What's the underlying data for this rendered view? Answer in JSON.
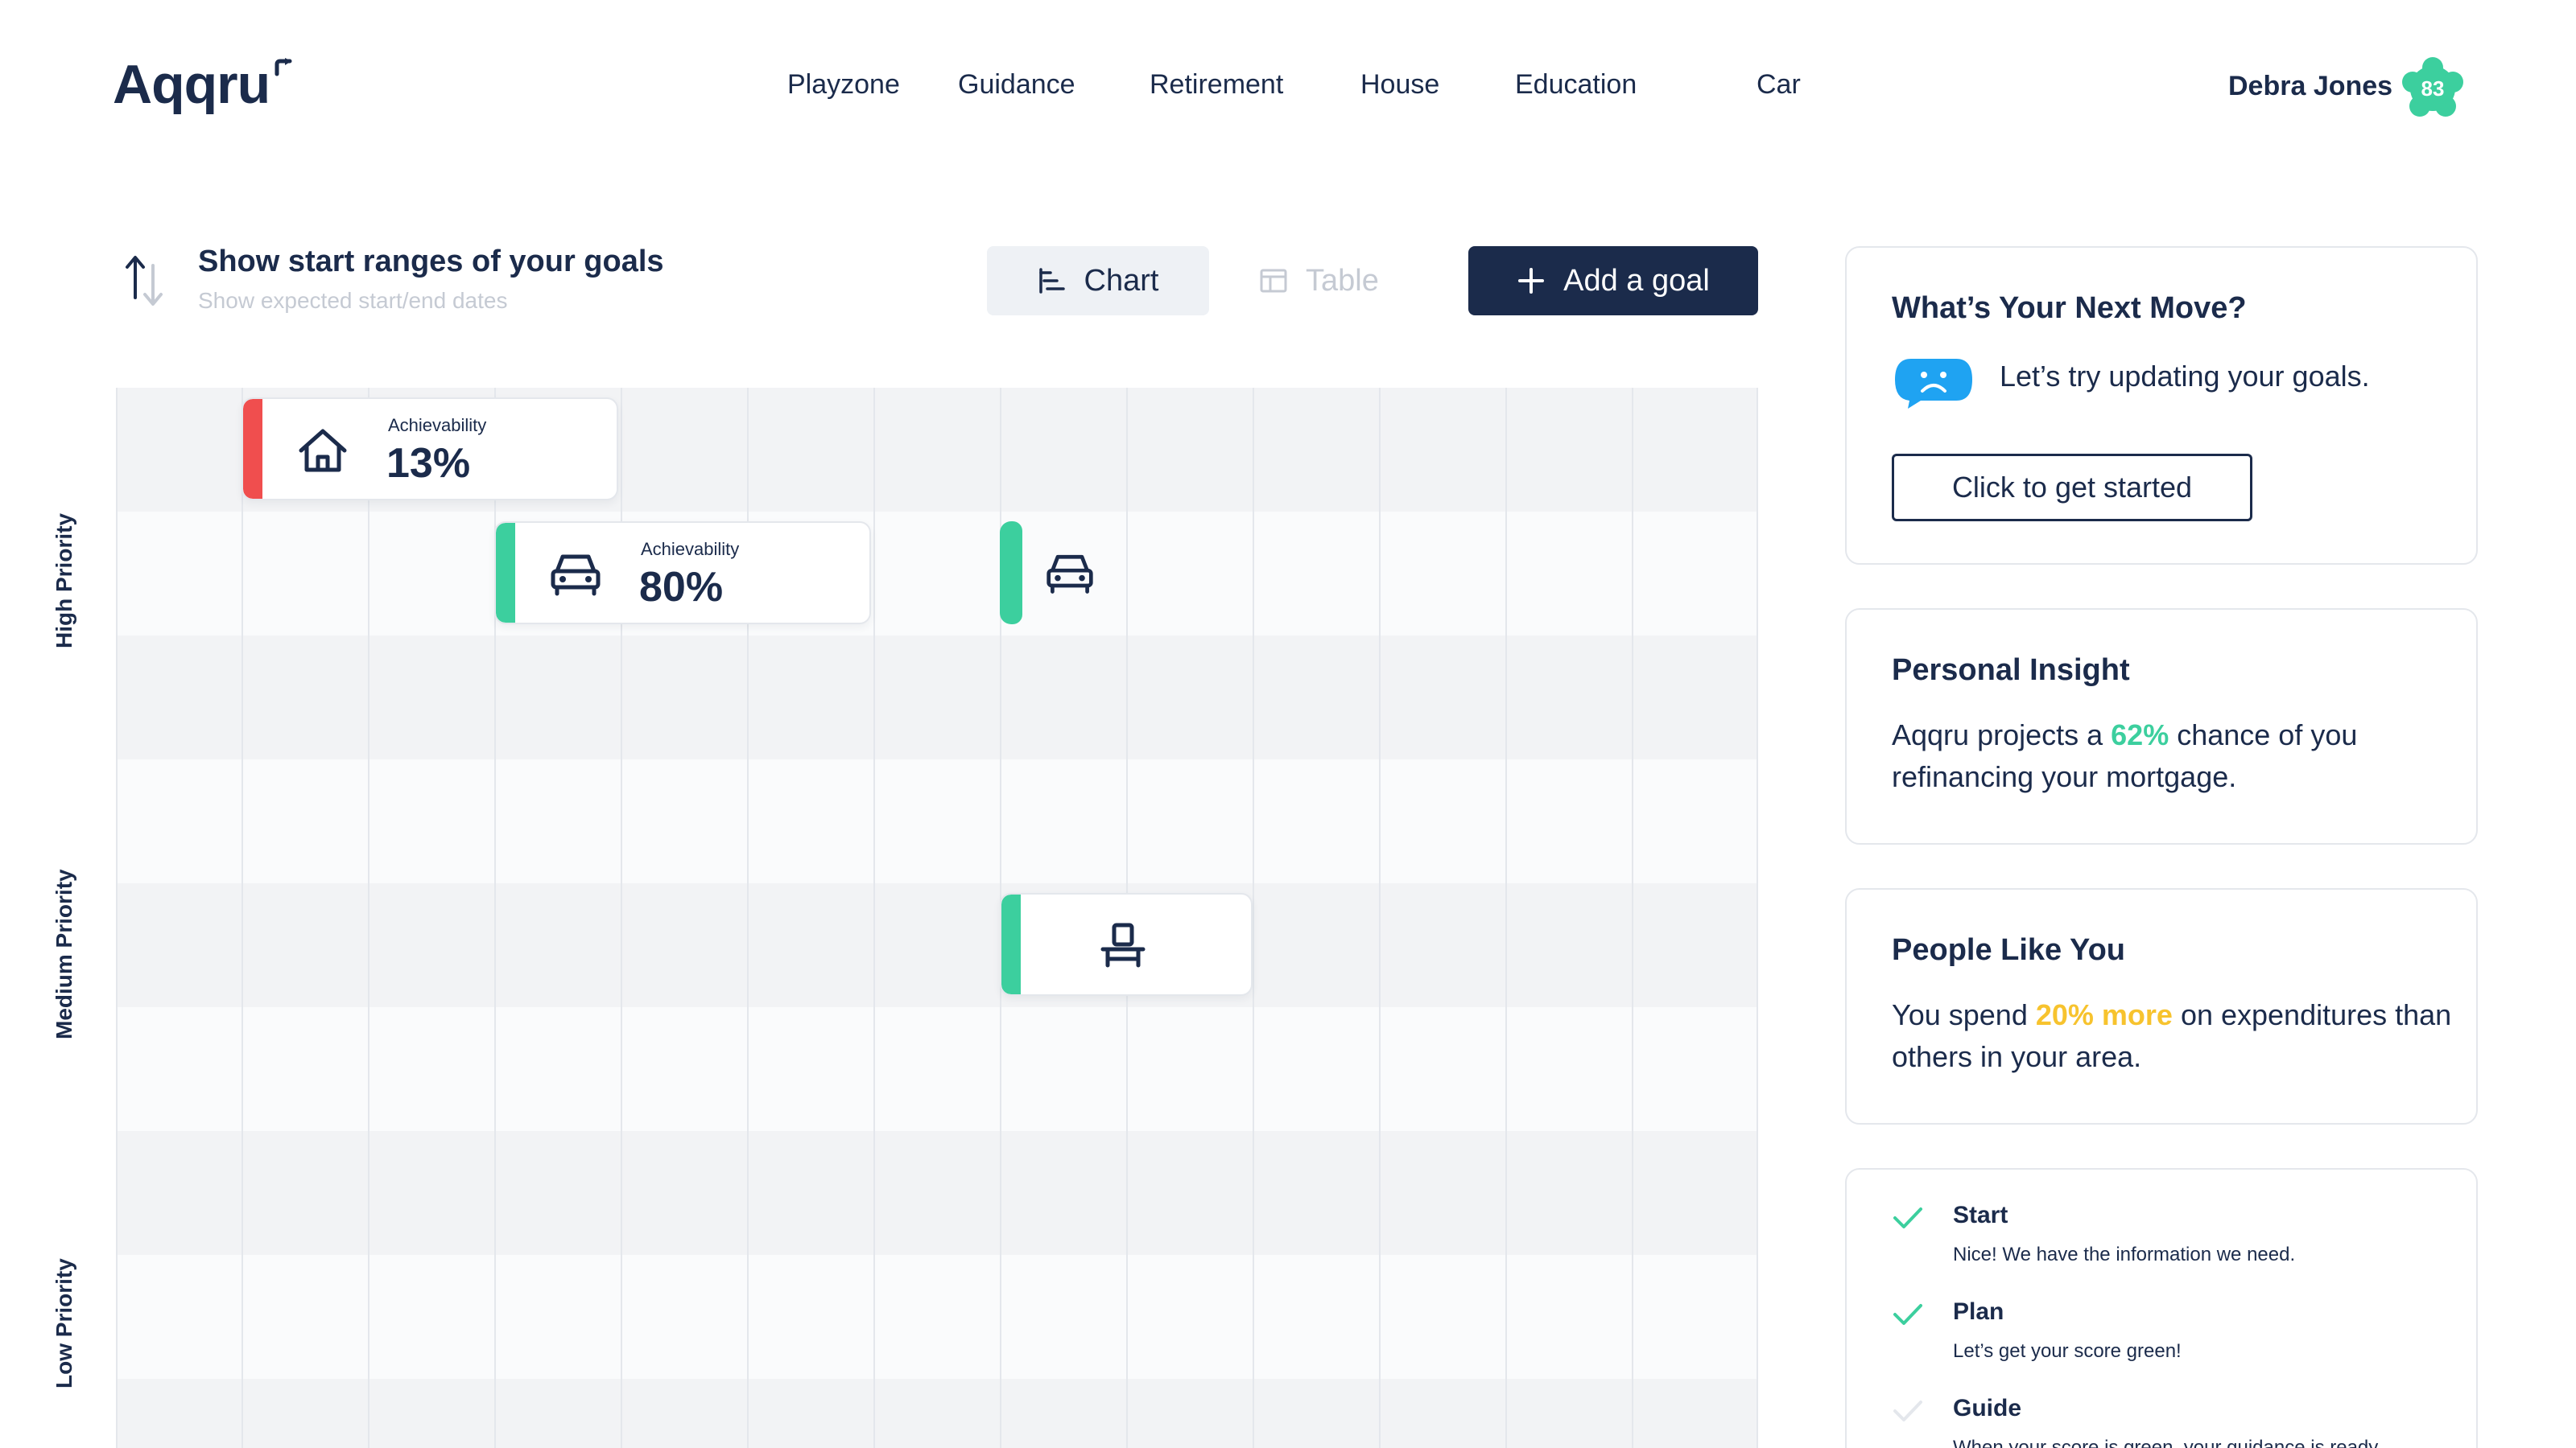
{
  "brand": {
    "name": "Aqqru"
  },
  "nav": {
    "items": [
      {
        "label": "Playzone"
      },
      {
        "label": "Guidance"
      },
      {
        "label": "Retirement"
      },
      {
        "label": "House"
      },
      {
        "label": "Education"
      },
      {
        "label": "Car"
      }
    ]
  },
  "user": {
    "name": "Debra Jones",
    "score": "83"
  },
  "toolbar": {
    "title": "Show start ranges of your goals",
    "subtitle": "Show expected start/end dates",
    "chart_label": "Chart",
    "table_label": "Table",
    "add_label": "Add a goal"
  },
  "priorities": {
    "high": "High Priority",
    "medium": "Medium Priority",
    "low": "Low Priority"
  },
  "goals": [
    {
      "icon": "house-icon",
      "status_color": "#f04e4e",
      "achievability_label": "Achievability",
      "achievability": "13%"
    },
    {
      "icon": "car-icon",
      "status_color": "#3ccf9e",
      "achievability_label": "Achievability",
      "achievability": "80%"
    },
    {
      "icon": "car-icon",
      "status_color": "#3ccf9e"
    },
    {
      "icon": "chair-icon",
      "status_color": "#3ccf9e"
    }
  ],
  "next_move": {
    "title": "What’s Your Next Move?",
    "message": "Let’s try updating your goals.",
    "button": "Click to get started",
    "icon": "sad-cloud-icon"
  },
  "insight": {
    "title": "Personal Insight",
    "text_before": "Aqqru projects a ",
    "highlight": "62%",
    "text_after": " chance of you refinancing your mortgage."
  },
  "people": {
    "title": "People Like You",
    "text_before": "You spend ",
    "highlight": "20% more",
    "text_after": " on expenditures than others in your area."
  },
  "steps": [
    {
      "title": "Start",
      "desc": "Nice! We have the information we need."
    },
    {
      "title": "Plan",
      "desc": "Let’s get your score green!"
    },
    {
      "title": "Guide",
      "desc": "When your score is green, your guidance is ready."
    }
  ],
  "colors": {
    "navy": "#1b2b4b",
    "green": "#3ccf9e",
    "red": "#f04e4e",
    "yellow": "#f7c32e",
    "blue": "#1fa3f2"
  }
}
